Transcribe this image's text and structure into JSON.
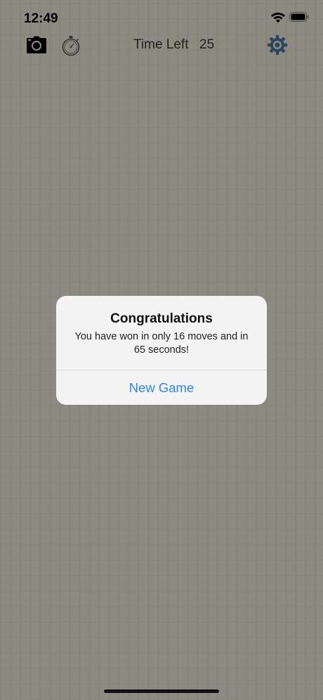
{
  "status_bar": {
    "time": "12:49"
  },
  "toolbar": {
    "icons": [
      "camera-icon",
      "stopwatch-icon",
      "gear-icon"
    ],
    "timer_label": "Time Left",
    "timer_value": "25"
  },
  "alert": {
    "title": "Congratulations",
    "message": "You have won in only 16 moves and in 65 seconds!",
    "button_label": "New Game"
  },
  "colors": {
    "background": "#8d8b81",
    "accent": "#2f86e6",
    "gear": "#2d4560"
  }
}
